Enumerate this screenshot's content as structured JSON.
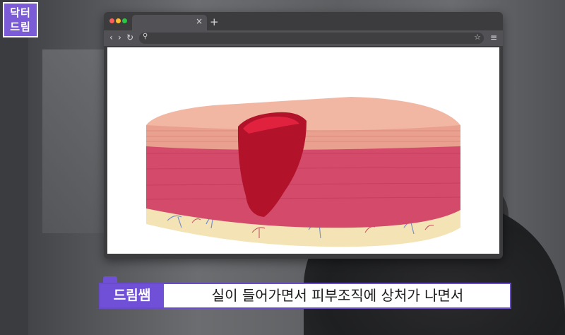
{
  "logo": {
    "line1": "닥터",
    "line2": "드림"
  },
  "browser": {
    "tab_close": "×",
    "tab_new": "+",
    "back": "‹",
    "forward": "›",
    "reload": "↻",
    "search_icon": "search-icon",
    "star": "☆",
    "menu": "≡"
  },
  "caption": {
    "speaker": "드림쌤",
    "text": "실이 들어가면서 피부조직에 상처가 나면서"
  },
  "colors": {
    "accent": "#7150d8",
    "wound": "#b3122b",
    "dermis": "#d44a6a",
    "epidermis": "#f2b7a3",
    "fat": "#f3e3b5"
  }
}
